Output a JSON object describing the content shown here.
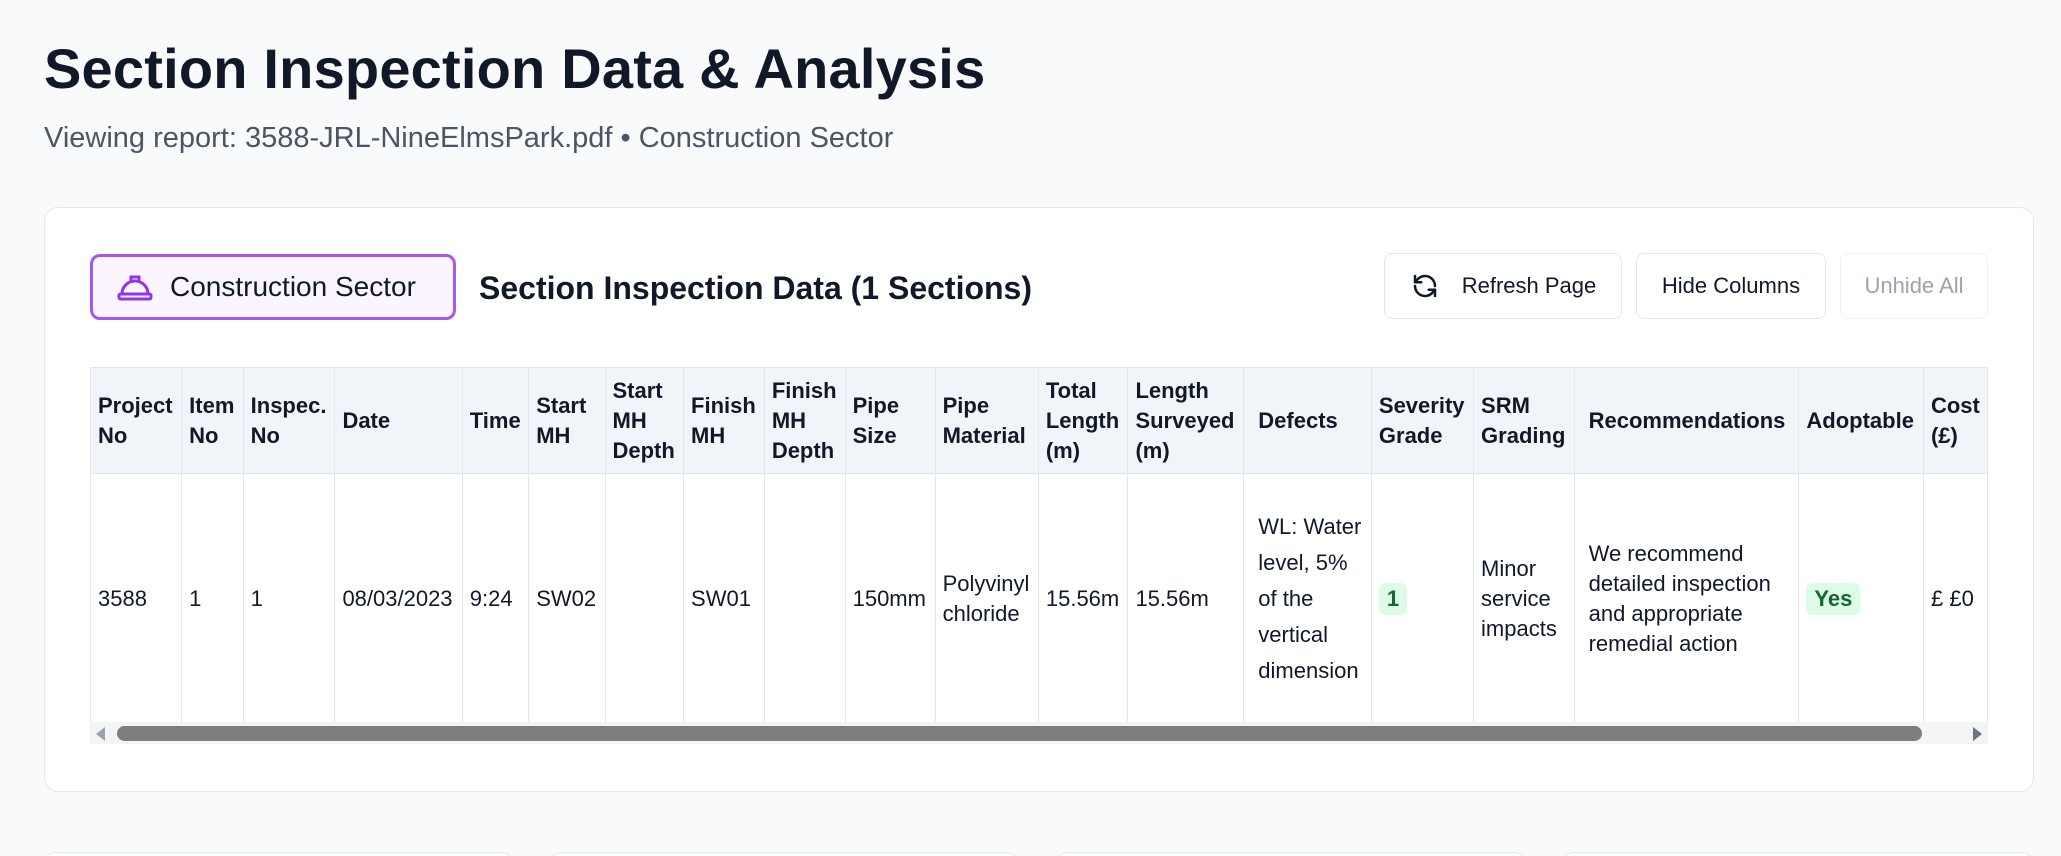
{
  "header": {
    "title": "Section Inspection Data & Analysis",
    "subtitle": "Viewing report: 3588-JRL-NineElmsPark.pdf • Construction Sector"
  },
  "card": {
    "sector_badge": {
      "label": "Construction Sector",
      "icon": "hard-hat-icon",
      "color": "#a855f7"
    },
    "section_title": "Section Inspection Data (1 Sections)",
    "buttons": {
      "refresh": "Refresh Page",
      "hide_columns": "Hide Columns",
      "unhide_all": "Unhide All"
    }
  },
  "table": {
    "headers": {
      "project_no": "Project No",
      "item_no": "Item No",
      "inspec_no": "Inspec. No",
      "date": "Date",
      "time": "Time",
      "start_mh": "Start MH",
      "start_mh_depth": "Start MH Depth",
      "finish_mh": "Finish MH",
      "finish_mh_depth": "Finish MH Depth",
      "pipe_size": "Pipe Size",
      "pipe_material": "Pipe Material",
      "total_length": "Total Length (m)",
      "length_surveyed": "Length Surveyed (m)",
      "defects": "Defects",
      "severity_grade": "Severity Grade",
      "srm_grading": "SRM Grading",
      "recommendations": "Recommendations",
      "adoptable": "Adoptable",
      "cost": "Cost (£)"
    },
    "row": {
      "project_no": "3588",
      "item_no": "1",
      "inspec_no": "1",
      "date": "08/03/2023",
      "time": "9:24",
      "start_mh": "SW02",
      "start_mh_depth": "",
      "finish_mh": "SW01",
      "finish_mh_depth": "",
      "pipe_size": "150mm",
      "pipe_material": "Polyvinyl chloride",
      "total_length": "15.56m",
      "length_surveyed": "15.56m",
      "defects": "WL: Water level, 5% of the vertical dimension",
      "severity_grade": "1",
      "srm_grading": "Minor service impacts",
      "recommendations": "We recommend detailed inspection and appropriate remedial action",
      "adoptable": "Yes",
      "cost": "£ £0"
    }
  },
  "colors": {
    "accent_purple": "#a855f7",
    "badge_green_bg": "#dcfce7",
    "badge_green_text": "#166534"
  }
}
